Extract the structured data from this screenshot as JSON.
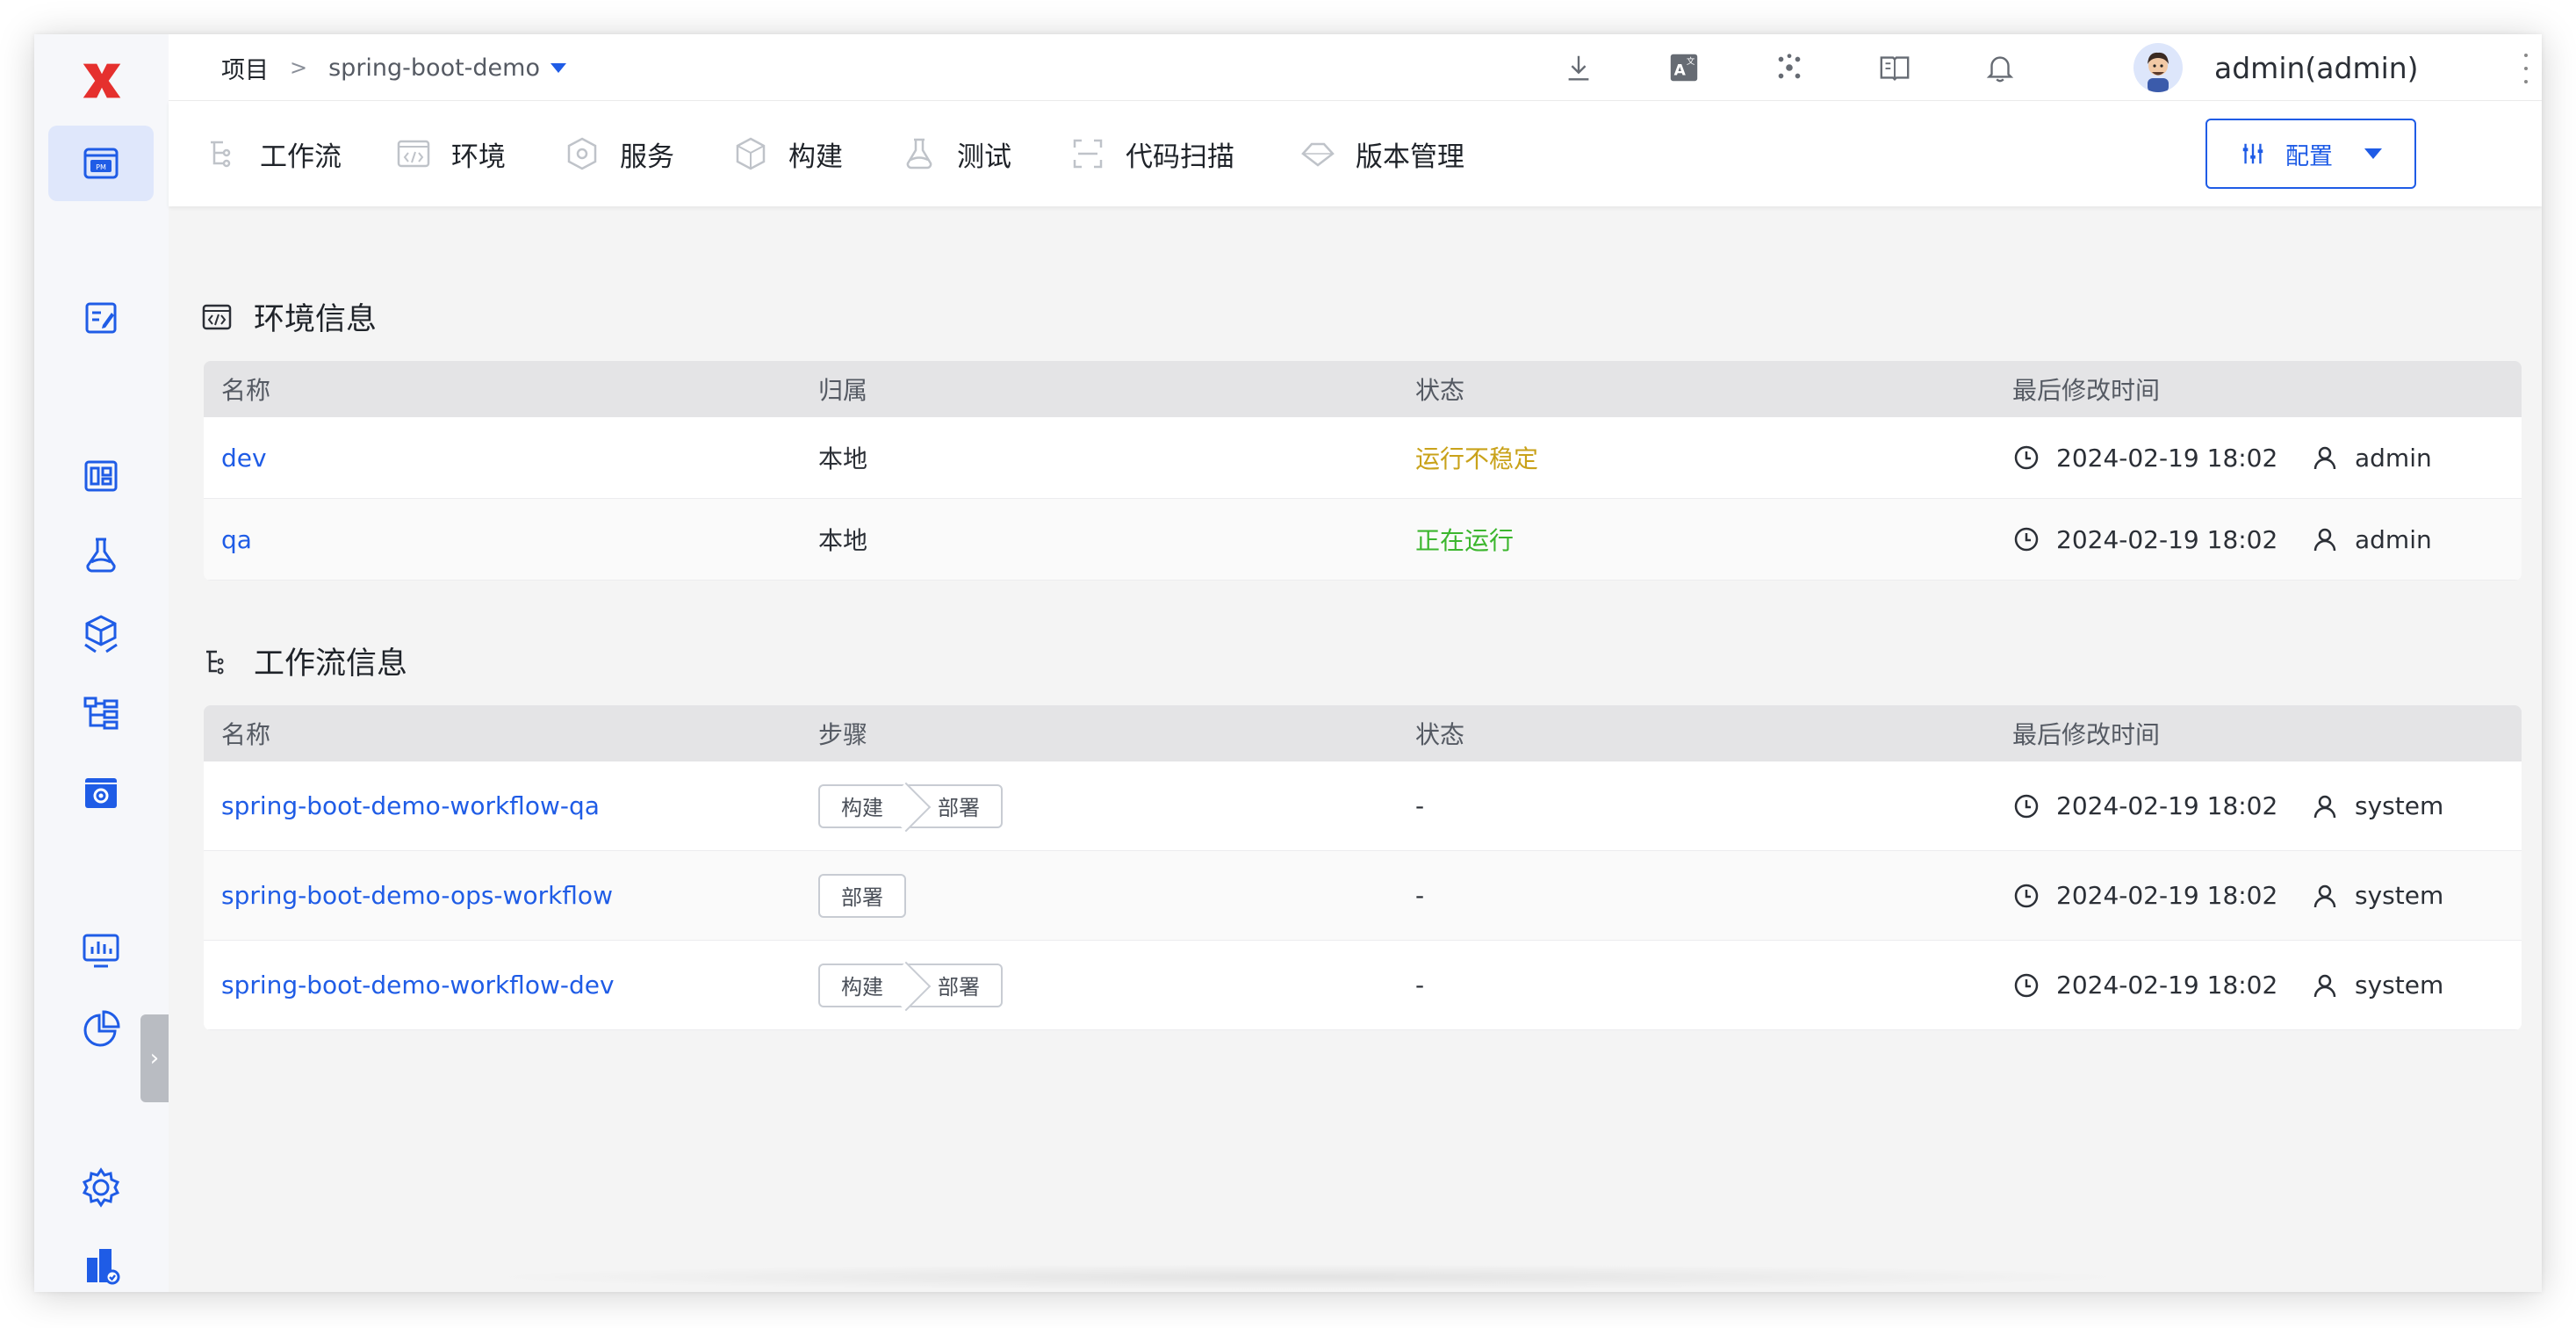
{
  "app": {
    "logo": "x-logo"
  },
  "sidebar": {
    "items": [
      {
        "name": "pm-icon",
        "active": true
      },
      {
        "name": "edit-doc-icon"
      },
      {
        "name": "dashboard-icon"
      },
      {
        "name": "flask-icon"
      },
      {
        "name": "package-icon"
      },
      {
        "name": "tree-icon"
      },
      {
        "name": "settings-box-icon"
      },
      {
        "name": "monitor-chart-icon"
      },
      {
        "name": "pie-chart-icon"
      },
      {
        "name": "gear-icon"
      },
      {
        "name": "building-icon"
      }
    ]
  },
  "breadcrumb": {
    "root": "项目",
    "separator": ">",
    "project": "spring-boot-demo"
  },
  "header": {
    "icons": [
      "download-icon",
      "translate-icon",
      "plugin-icon",
      "book-icon",
      "bell-icon"
    ],
    "user": "admin(admin)"
  },
  "tabs": [
    {
      "label": "工作流",
      "icon": "workflow-icon"
    },
    {
      "label": "环境",
      "icon": "code-env-icon"
    },
    {
      "label": "服务",
      "icon": "service-icon"
    },
    {
      "label": "构建",
      "icon": "build-icon"
    },
    {
      "label": "测试",
      "icon": "test-icon"
    },
    {
      "label": "代码扫描",
      "icon": "scan-icon"
    },
    {
      "label": "版本管理",
      "icon": "version-icon"
    }
  ],
  "config_button": {
    "label": "配置"
  },
  "env_section": {
    "title": "环境信息",
    "headers": [
      "名称",
      "归属",
      "状态",
      "最后修改时间"
    ],
    "rows": [
      {
        "name": "dev",
        "owner": "本地",
        "status": "运行不稳定",
        "status_type": "warn",
        "time": "2024-02-19 18:02",
        "user": "admin"
      },
      {
        "name": "qa",
        "owner": "本地",
        "status": "正在运行",
        "status_type": "ok",
        "time": "2024-02-19 18:02",
        "user": "admin"
      }
    ]
  },
  "workflow_section": {
    "title": "工作流信息",
    "headers": [
      "名称",
      "步骤",
      "状态",
      "最后修改时间"
    ],
    "rows": [
      {
        "name": "spring-boot-demo-workflow-qa",
        "steps": [
          "构建",
          "部署"
        ],
        "status": "-",
        "time": "2024-02-19 18:02",
        "user": "system"
      },
      {
        "name": "spring-boot-demo-ops-workflow",
        "steps": [
          "部署"
        ],
        "status": "-",
        "time": "2024-02-19 18:02",
        "user": "system"
      },
      {
        "name": "spring-boot-demo-workflow-dev",
        "steps": [
          "构建",
          "部署"
        ],
        "status": "-",
        "time": "2024-02-19 18:02",
        "user": "system"
      }
    ]
  },
  "colors": {
    "accent": "#1f5ce6",
    "warn": "#c9a21a",
    "ok": "#3cb62e",
    "logo": "#e5302e"
  }
}
